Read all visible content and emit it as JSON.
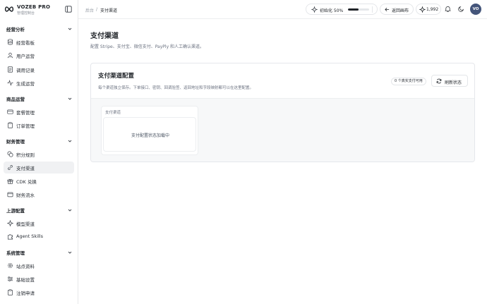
{
  "brand": {
    "title": "VOZEB PRO",
    "subtitle": "管理控制台"
  },
  "sidebar": {
    "groups": [
      {
        "label": "经营分析",
        "items": [
          {
            "label": "经营看板",
            "icon": "database-icon"
          },
          {
            "label": "用户运营",
            "icon": "user-icon"
          },
          {
            "label": "调用记录",
            "icon": "document-icon"
          },
          {
            "label": "生成运营",
            "icon": "pulse-icon"
          }
        ]
      },
      {
        "label": "商品运营",
        "items": [
          {
            "label": "套餐管理",
            "icon": "card-icon"
          },
          {
            "label": "订单管理",
            "icon": "clipboard-icon"
          }
        ]
      },
      {
        "label": "财务管理",
        "items": [
          {
            "label": "积分规则",
            "icon": "coins-icon"
          },
          {
            "label": "支付渠道",
            "icon": "link-icon",
            "active": true
          },
          {
            "label": "CDK 兑换",
            "icon": "gift-icon"
          },
          {
            "label": "财务流水",
            "icon": "wallet-icon"
          }
        ]
      },
      {
        "label": "上游配置",
        "items": [
          {
            "label": "模型渠道",
            "icon": "sparkle-icon"
          },
          {
            "label": "Agent Skills",
            "icon": "puzzle-icon"
          }
        ]
      },
      {
        "label": "系统管理",
        "items": [
          {
            "label": "站点资料",
            "icon": "gear-icon"
          },
          {
            "label": "基础设置",
            "icon": "sliders-icon"
          },
          {
            "label": "注销申请",
            "icon": "clipboard-icon"
          }
        ]
      }
    ]
  },
  "topbar": {
    "breadcrumb": {
      "home": "后台",
      "separator": "/",
      "current": "支付渠道"
    },
    "init": {
      "label": "初始化 50%",
      "progress": 0.5
    },
    "back_label": "返回画布",
    "stars": "1,992",
    "avatar": "VO"
  },
  "page": {
    "title": "支付渠道",
    "description": "配置 Stripe、支付宝、微信支付、PayPly 和人工确认渠道。"
  },
  "card": {
    "title": "支付渠道配置",
    "description": "每个渠道独立保存。下单接口、密钥、回调验签、返回地址和字段映射都可以在这里配置。",
    "badge": "0 个真实支付可用",
    "refresh_label": "刷新状态",
    "panel_label": "支付渠道",
    "loading": "支付配置状态加载中"
  },
  "colors": {
    "accent": "#1f2328",
    "avatar_bg": "#44557a",
    "active_bg": "#f0f1f3"
  }
}
